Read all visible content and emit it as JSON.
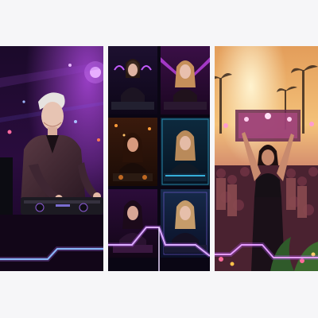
{
  "collage": {
    "panel_count": 3,
    "panels": [
      {
        "name": "dj-club-panel",
        "subject": "dj-performer",
        "palette": [
          "#1a0726",
          "#7a2bb8",
          "#c54dff"
        ]
      },
      {
        "name": "dj-grid-panel",
        "subject": "dj-portrait-grid",
        "tiles": 6,
        "palette": [
          "#0c0a1c",
          "#a33bd6",
          "#3fd0ff",
          "#ff8a2a"
        ]
      },
      {
        "name": "festival-panel",
        "subject": "festival-crowd",
        "palette": [
          "#f6b25a",
          "#c5488e",
          "#3a1230"
        ]
      }
    ],
    "accent_colors": {
      "neon_purple": "#c45bff",
      "neon_blue": "#7fd9ff",
      "sunset": "#ffd08a"
    }
  }
}
